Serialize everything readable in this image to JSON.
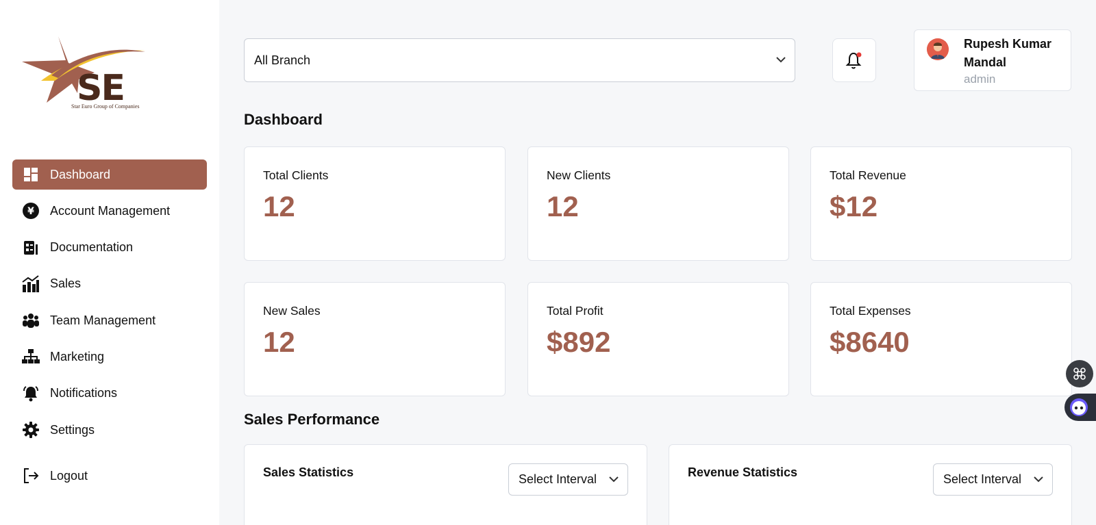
{
  "brand": {
    "logo_text": "SE",
    "caption": "Star Euro Group of Companies"
  },
  "sidebar": {
    "items": [
      {
        "label": "Dashboard",
        "icon": "dashboard-icon",
        "active": true
      },
      {
        "label": "Account Management",
        "icon": "yen-coin-icon",
        "active": false
      },
      {
        "label": "Documentation",
        "icon": "document-icon",
        "active": false
      },
      {
        "label": "Sales",
        "icon": "sales-chart-icon",
        "active": false
      },
      {
        "label": "Team Management",
        "icon": "team-icon",
        "active": false
      },
      {
        "label": "Marketing",
        "icon": "hierarchy-icon",
        "active": false
      },
      {
        "label": "Notifications",
        "icon": "bell-icon",
        "active": false
      },
      {
        "label": "Settings",
        "icon": "gear-icon",
        "active": false
      }
    ],
    "logout_label": "Logout"
  },
  "header": {
    "branch_select": "All Branch",
    "notification_icon": "bell-icon",
    "user": {
      "name": "Rupesh Kumar Mandal",
      "role": "admin"
    }
  },
  "dashboard": {
    "title": "Dashboard",
    "stats": [
      {
        "label": "Total Clients",
        "value": "12"
      },
      {
        "label": "New Clients",
        "value": "12"
      },
      {
        "label": "Total Revenue",
        "value": "$12"
      },
      {
        "label": "New Sales",
        "value": "12"
      },
      {
        "label": "Total Profit",
        "value": "$892"
      },
      {
        "label": "Total Expenses",
        "value": "$8640"
      }
    ]
  },
  "performance": {
    "title": "Sales Performance",
    "sales_card": {
      "title": "Sales Statistics",
      "interval": "Select Interval"
    },
    "revenue_card": {
      "title": "Revenue Statistics",
      "interval": "Select Interval"
    }
  },
  "colors": {
    "accent": "#a1604f",
    "background": "#f6f7f9",
    "notification_dot": "#e53935"
  }
}
